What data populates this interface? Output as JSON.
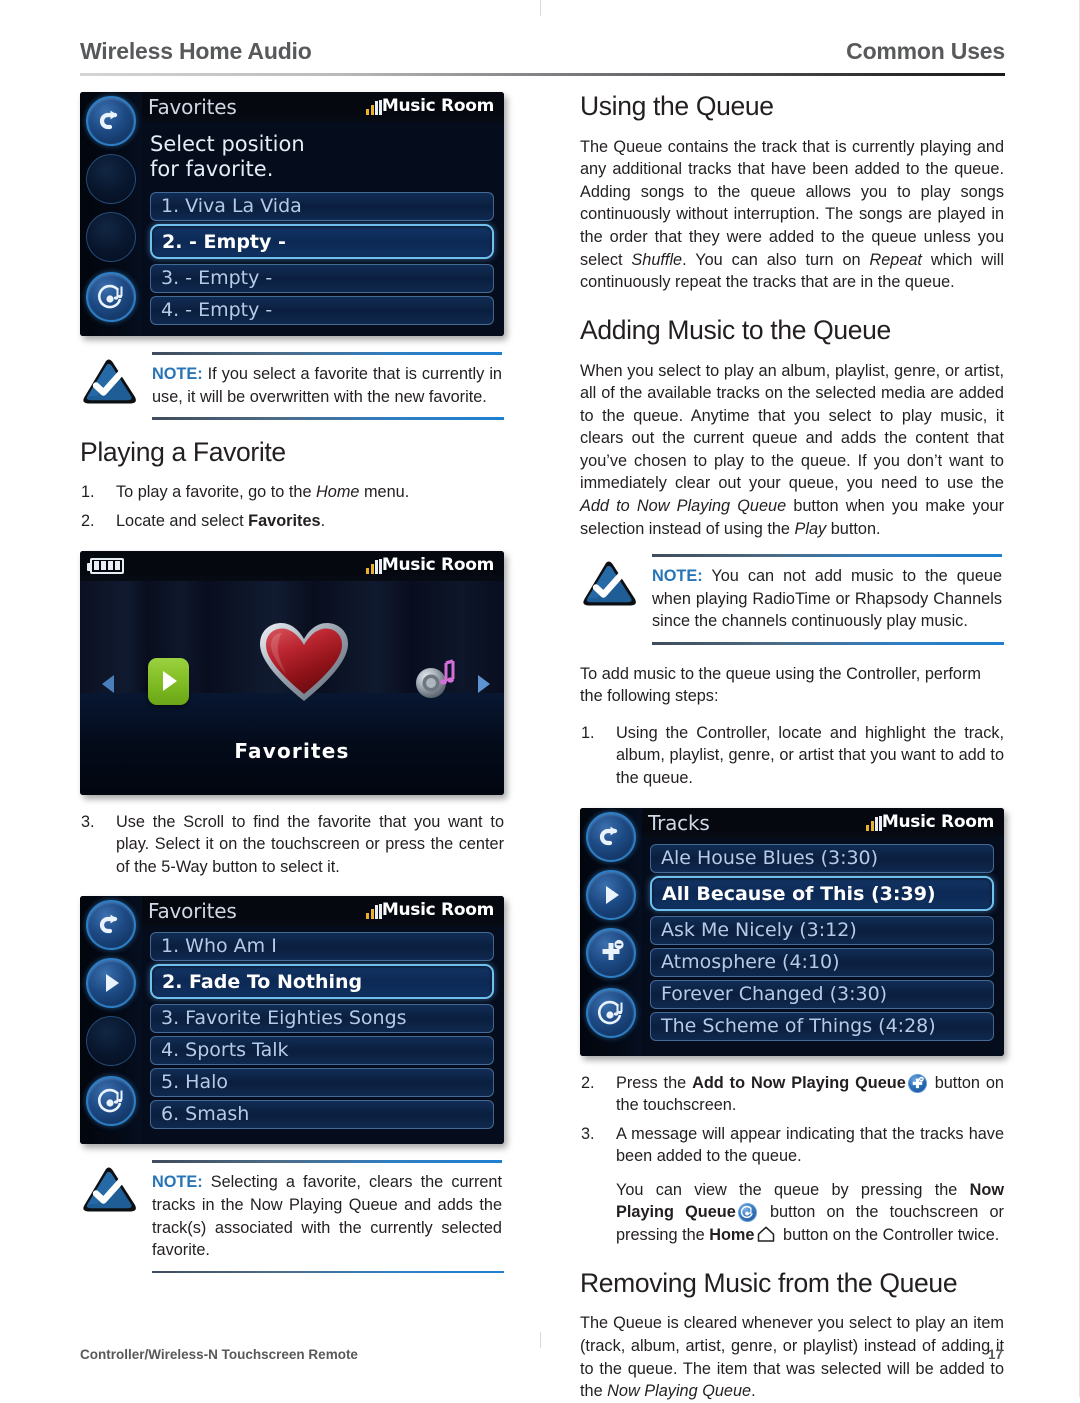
{
  "header": {
    "left_title": "Wireless Home Audio",
    "right_title": "Common Uses"
  },
  "footer": {
    "left_text": "Controller/Wireless-N Touchscreen Remote",
    "page_number": "17"
  },
  "colors": {
    "note_label": "#2775b6",
    "body_text": "#231f20",
    "header_text": "#58595b",
    "device_highlight": "#6fc0ef",
    "signal_amber": "#e8b32a",
    "play_green": "#7fbb22",
    "heart_red": "#b9212a"
  },
  "left_column": {
    "screen_select_position": {
      "title": "Favorites",
      "room": "Music Room",
      "prompt_line1": "Select position",
      "prompt_line2": "for favorite.",
      "rows": [
        {
          "label": "1. Viva La Vida",
          "selected": false
        },
        {
          "label": "2. - Empty -",
          "selected": true
        },
        {
          "label": "3. - Empty -",
          "selected": false
        },
        {
          "label": "4. - Empty -",
          "selected": false
        }
      ],
      "rail_icons": [
        "back-icon",
        "blank-button",
        "blank-button",
        "now-playing-icon"
      ]
    },
    "note_overwrite": {
      "label": "NOTE:",
      "text": " If you select a favorite that is currently in use, it will be overwritten with the new favorite."
    },
    "heading_playing_favorite": "Playing a Favorite",
    "steps_playing_favorite": [
      {
        "num": "1.",
        "text_before": "To play a favorite, go to the ",
        "italic": "Home",
        "text_after": " menu."
      },
      {
        "num": "2.",
        "text_before": "Locate and select ",
        "bold": "Favorites",
        "text_after": "."
      }
    ],
    "screen_favorites_carousel": {
      "room": "Music Room",
      "center_label": "Favorites",
      "left_icon": "play-tile-icon",
      "right_icon": "speaker-music-icon",
      "battery": "battery-full-icon"
    },
    "step3": {
      "num": "3.",
      "text": "Use the Scroll to find the favorite that you want to play. Select it on the touchscreen or press the center of the 5-Way button to select it."
    },
    "screen_favorites_list": {
      "title": "Favorites",
      "room": "Music Room",
      "rows": [
        {
          "label": "1. Who Am I",
          "selected": false
        },
        {
          "label": "2. Fade To Nothing",
          "selected": true
        },
        {
          "label": "3. Favorite Eighties Songs",
          "selected": false
        },
        {
          "label": "4. Sports Talk",
          "selected": false
        },
        {
          "label": "5. Halo",
          "selected": false
        },
        {
          "label": "6. Smash",
          "selected": false
        }
      ],
      "rail_icons": [
        "back-icon",
        "play-icon",
        "blank-button",
        "now-playing-icon"
      ]
    },
    "note_selecting": {
      "label": "NOTE:",
      "text": " Selecting a favorite, clears the current tracks in the Now Playing Queue and adds the track(s) associated with the currently selected favorite."
    }
  },
  "right_column": {
    "heading_using_queue": "Using the Queue",
    "para_using_queue_a": "The Queue contains the track that is currently playing and any additional tracks that have been added to the queue. Adding songs to the queue allows you to play songs continuously without interruption. The songs are played in the order that they were added to the queue unless you select ",
    "para_using_queue_shuffle": "Shuffle",
    "para_using_queue_b": ". You can also turn on ",
    "para_using_queue_repeat": "Repeat",
    "para_using_queue_c": " which will continuously repeat the tracks that are in the queue.",
    "heading_adding_music": "Adding Music to the Queue",
    "para_adding_a": "When you select to play an album, playlist, genre, or artist, all of the available tracks on the selected media are added to the queue. Anytime that you select to play music, it clears out the current queue and adds the content that you’ve chosen to play to the queue. If you don’t want to immediately clear out your queue, you need to use the ",
    "para_adding_italic1": "Add to Now Playing Queue",
    "para_adding_b": " button when you make your selection instead of using the ",
    "para_adding_italic2": "Play",
    "para_adding_c": " button.",
    "note_radiotime": {
      "label": "NOTE:",
      "text": " You can not add music to the queue when playing RadioTime or Rhapsody Channels since the channels continuously play music."
    },
    "para_to_add": "To add music to the queue using the Controller, perform the following steps:",
    "step1": {
      "num": "1.",
      "text": "Using the Controller, locate and highlight the track, album, playlist, genre, or artist that you want to add to the queue."
    },
    "screen_tracks": {
      "title": "Tracks",
      "room": "Music Room",
      "rows": [
        {
          "label": "Ale House Blues (3:30)",
          "selected": false
        },
        {
          "label": "All Because of This (3:39)",
          "selected": true
        },
        {
          "label": "Ask Me Nicely (3:12)",
          "selected": false
        },
        {
          "label": "Atmosphere (4:10)",
          "selected": false
        },
        {
          "label": "Forever Changed (3:30)",
          "selected": false
        },
        {
          "label": "The Scheme of Things (4:28)",
          "selected": false
        }
      ],
      "rail_icons": [
        "back-icon",
        "play-icon",
        "add-to-queue-icon",
        "now-playing-icon"
      ]
    },
    "step2": {
      "num": "2.",
      "text_before": "Press the ",
      "bold": "Add to Now Playing Queue",
      "icon": "add-to-queue-icon",
      "text_after": " button on the touchscreen."
    },
    "step3": {
      "num": "3.",
      "text": "A message will appear indicating that the tracks have been added to the queue."
    },
    "step3_sub": {
      "text_a": "You can view the queue by pressing the ",
      "bold_a": "Now Playing Queue",
      "icon_a": "now-playing-queue-icon",
      "text_b": " button on the touchscreen or pressing the ",
      "bold_b": "Home",
      "icon_b": "home-icon",
      "text_c": " button on the Controller twice."
    },
    "heading_removing_music": "Removing Music from the Queue",
    "para_removing_a": "The Queue is cleared whenever you select to play an item (track, album, artist, genre, or playlist) instead of adding it to the queue. The item that was selected will be added to the ",
    "para_removing_italic": "Now Playing Queue",
    "para_removing_b": "."
  }
}
